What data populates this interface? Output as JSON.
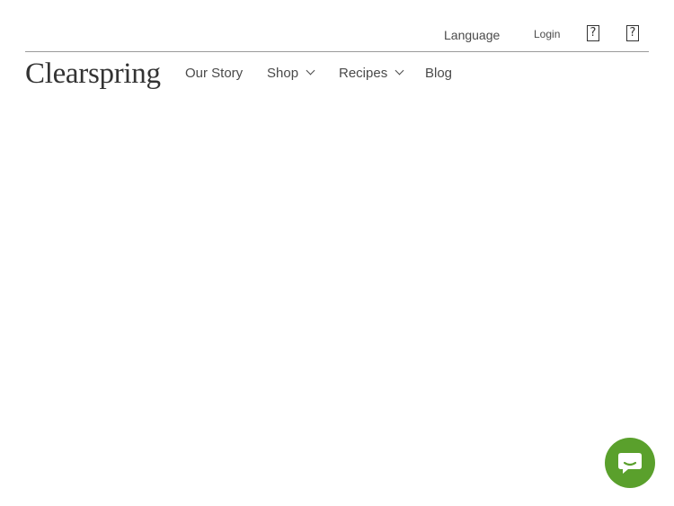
{
  "utility": {
    "language_label": "Language",
    "login_label": "Login",
    "icons": [
      "missing-glyph-icon",
      "missing-glyph-icon"
    ],
    "icon_glyph": "?"
  },
  "nav": {
    "logo_text": "Clearspring",
    "items": [
      {
        "label": "Our Story",
        "has_dropdown": false
      },
      {
        "label": "Shop",
        "has_dropdown": true
      },
      {
        "label": "Recipes",
        "has_dropdown": true
      },
      {
        "label": "Blog",
        "has_dropdown": false
      }
    ]
  },
  "chat": {
    "icon": "chat-bubble-icon",
    "color": "#5aa02c"
  },
  "colors": {
    "text": "#3d3d3d",
    "divider": "#9a9a9a",
    "accent": "#5aa02c"
  }
}
